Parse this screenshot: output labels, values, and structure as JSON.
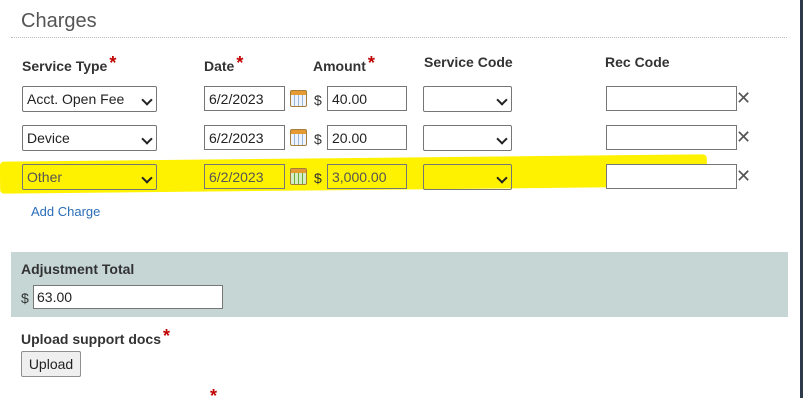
{
  "section": {
    "title": "Charges"
  },
  "headers": {
    "service_type": "Service Type",
    "date": "Date",
    "amount": "Amount",
    "service_code": "Service Code",
    "rec_code": "Rec Code",
    "required_marker": "*"
  },
  "rows": [
    {
      "service_type": "Acct. Open Fee",
      "date": "6/2/2023",
      "currency": "$",
      "amount": "40.00",
      "service_code": "",
      "rec_code": "",
      "remove": "✕",
      "highlighted": false
    },
    {
      "service_type": "Device",
      "date": "6/2/2023",
      "currency": "$",
      "amount": "20.00",
      "service_code": "",
      "rec_code": "",
      "remove": "✕",
      "highlighted": false
    },
    {
      "service_type": "Other",
      "date": "6/2/2023",
      "currency": "$",
      "amount": "3,000.00",
      "service_code": "",
      "rec_code": "",
      "remove": "✕",
      "highlighted": true
    }
  ],
  "add_charge_label": "Add Charge",
  "adjustment": {
    "label": "Adjustment Total",
    "currency": "$",
    "value": "63.00"
  },
  "upload": {
    "label": "Upload support docs",
    "required_marker": "*",
    "button_label": "Upload"
  },
  "footer": {
    "required_marker": "*"
  },
  "colors": {
    "highlight": "#fff200",
    "panel": "#c5d6d5",
    "link": "#2a6eb8",
    "required": "#c00000"
  },
  "icons": {
    "calendar": "calendar-icon",
    "remove": "close-icon",
    "dropdown": "chevron-down-icon"
  }
}
